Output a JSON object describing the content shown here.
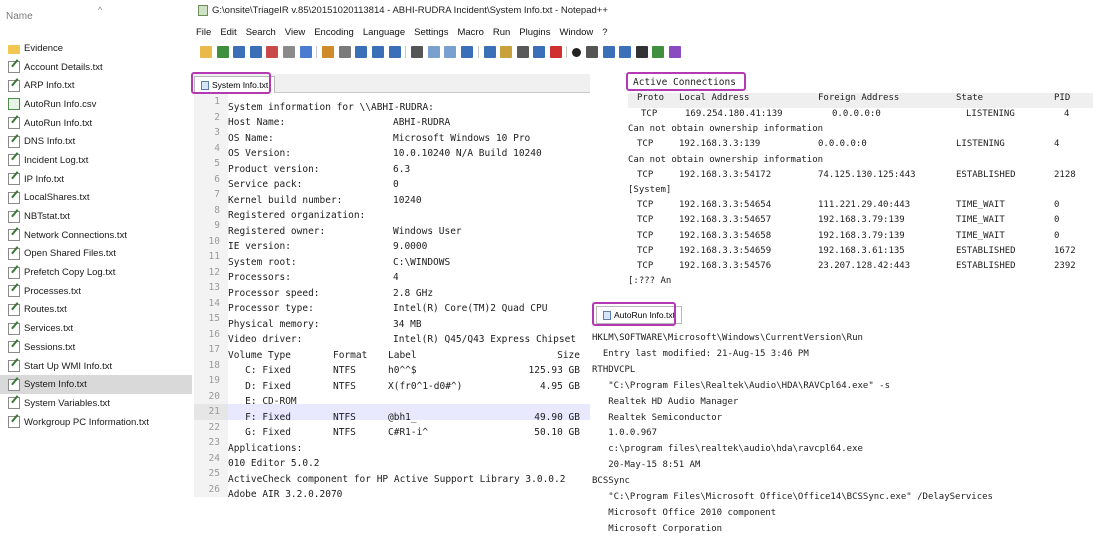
{
  "explorer": {
    "header": "Name",
    "sort_glyph": "^",
    "items": [
      {
        "label": "Evidence",
        "icon": "folder-icon"
      },
      {
        "label": "Account Details.txt",
        "icon": "text-file-icon"
      },
      {
        "label": "ARP Info.txt",
        "icon": "text-file-icon"
      },
      {
        "label": "AutoRun Info.csv",
        "icon": "csv-file-icon"
      },
      {
        "label": "AutoRun Info.txt",
        "icon": "text-file-icon"
      },
      {
        "label": "DNS Info.txt",
        "icon": "text-file-icon"
      },
      {
        "label": "Incident Log.txt",
        "icon": "text-file-icon"
      },
      {
        "label": "IP Info.txt",
        "icon": "text-file-icon"
      },
      {
        "label": "LocalShares.txt",
        "icon": "text-file-icon"
      },
      {
        "label": "NBTstat.txt",
        "icon": "text-file-icon"
      },
      {
        "label": "Network Connections.txt",
        "icon": "text-file-icon"
      },
      {
        "label": "Open Shared Files.txt",
        "icon": "text-file-icon"
      },
      {
        "label": "Prefetch Copy Log.txt",
        "icon": "text-file-icon"
      },
      {
        "label": "Processes.txt",
        "icon": "text-file-icon"
      },
      {
        "label": "Routes.txt",
        "icon": "text-file-icon"
      },
      {
        "label": "Services.txt",
        "icon": "text-file-icon"
      },
      {
        "label": "Sessions.txt",
        "icon": "text-file-icon"
      },
      {
        "label": "Start Up WMI Info.txt",
        "icon": "text-file-icon"
      },
      {
        "label": "System Info.txt",
        "icon": "text-file-icon",
        "selected": true
      },
      {
        "label": "System Variables.txt",
        "icon": "text-file-icon"
      },
      {
        "label": "Workgroup PC Information.txt",
        "icon": "text-file-icon"
      }
    ]
  },
  "window": {
    "title": "G:\\onsite\\TriageIR v.85\\20151020113814 - ABHI-RUDRA Incident\\System Info.txt - Notepad++",
    "menu": [
      "File",
      "Edit",
      "Search",
      "View",
      "Encoding",
      "Language",
      "Settings",
      "Macro",
      "Run",
      "Plugins",
      "Window",
      "?"
    ],
    "accent_highlight": "#b33ab3"
  },
  "editor": {
    "tab_label": "System Info.txt",
    "lines": [
      {
        "n": "1",
        "cols": [
          "System information for \\\\ABHI-RUDRA:"
        ]
      },
      {
        "n": "2",
        "cols": [
          "Host Name:",
          "ABHI-RUDRA"
        ]
      },
      {
        "n": "3",
        "cols": [
          "OS Name:",
          "Microsoft Windows 10 Pro"
        ]
      },
      {
        "n": "4",
        "cols": [
          "OS Version:",
          "10.0.10240 N/A Build 10240"
        ]
      },
      {
        "n": "5",
        "cols": [
          "Product version:",
          "6.3"
        ]
      },
      {
        "n": "6",
        "cols": [
          "Service pack:",
          "0"
        ]
      },
      {
        "n": "7",
        "cols": [
          "Kernel build number:",
          "10240"
        ]
      },
      {
        "n": "8",
        "cols": [
          "Registered organization:"
        ]
      },
      {
        "n": "9",
        "cols": [
          "Registered owner:",
          "Windows User"
        ]
      },
      {
        "n": "10",
        "cols": [
          "IE version:",
          "9.0000"
        ]
      },
      {
        "n": "11",
        "cols": [
          "System root:",
          "C:\\WINDOWS"
        ]
      },
      {
        "n": "12",
        "cols": [
          "Processors:",
          "4"
        ]
      },
      {
        "n": "13",
        "cols": [
          "Processor speed:",
          "2.8 GHz"
        ]
      },
      {
        "n": "14",
        "cols": [
          "Processor type:",
          "Intel(R) Core(TM)2 Quad CPU"
        ]
      },
      {
        "n": "15",
        "cols": [
          "Physical memory:",
          "34 MB"
        ]
      },
      {
        "n": "16",
        "cols": [
          "Video driver:",
          "Intel(R) Q45/Q43 Express Chipset"
        ]
      },
      {
        "n": "17",
        "cols": [
          "Volume Type",
          "Format",
          "Label",
          "Size"
        ],
        "vol": true
      },
      {
        "n": "18",
        "cols": [
          "   C: Fixed",
          "NTFS",
          "h0^^$",
          "125.93 GB"
        ],
        "vol": true
      },
      {
        "n": "19",
        "cols": [
          "   D: Fixed",
          "NTFS",
          "X(fr0^1-d0#^)",
          "4.95 GB"
        ],
        "vol": true
      },
      {
        "n": "20",
        "cols": [
          "   E: CD-ROM"
        ],
        "vol": true
      },
      {
        "n": "21",
        "cols": [
          "   F: Fixed",
          "NTFS",
          "@bh1_",
          "49.90 GB"
        ],
        "vol": true,
        "current": true
      },
      {
        "n": "22",
        "cols": [
          "   G: Fixed",
          "NTFS",
          "C#R1-i^",
          "50.10 GB"
        ],
        "vol": true
      },
      {
        "n": "23",
        "cols": [
          "Applications:"
        ]
      },
      {
        "n": "24",
        "cols": [
          "010 Editor 5.0.2"
        ]
      },
      {
        "n": "25",
        "cols": [
          "ActiveCheck component for HP Active Support Library 3.0.0.2"
        ]
      },
      {
        "n": "26",
        "cols": [
          "Adobe AIR 3.2.0.2070"
        ]
      }
    ]
  },
  "connections": {
    "title": "Active Connections",
    "headers": [
      "Proto",
      "Local Address",
      "Foreign Address",
      "State",
      "PID"
    ],
    "rows": [
      {
        "cells": [
          "TCP",
          "169.254.180.41:139",
          "0.0.0.0:0",
          "LISTENING",
          "4"
        ],
        "indent": true
      },
      {
        "text": "Can not obtain ownership information"
      },
      {
        "cells": [
          "TCP",
          "192.168.3.3:139",
          "0.0.0.0:0",
          "LISTENING",
          "4"
        ]
      },
      {
        "text": "Can not obtain ownership information"
      },
      {
        "cells": [
          "TCP",
          "192.168.3.3:54172",
          "74.125.130.125:443",
          "ESTABLISHED",
          "2128"
        ]
      },
      {
        "text": "[System]"
      },
      {
        "cells": [
          "TCP",
          "192.168.3.3:54654",
          "111.221.29.40:443",
          "TIME_WAIT",
          "0"
        ]
      },
      {
        "cells": [
          "TCP",
          "192.168.3.3:54657",
          "192.168.3.79:139",
          "TIME_WAIT",
          "0"
        ]
      },
      {
        "cells": [
          "TCP",
          "192.168.3.3:54658",
          "192.168.3.79:139",
          "TIME_WAIT",
          "0"
        ]
      },
      {
        "cells": [
          "TCP",
          "192.168.3.3:54659",
          "192.168.3.61:135",
          "ESTABLISHED",
          "1672"
        ]
      },
      {
        "cells": [
          "TCP",
          "192.168.3.3:54576",
          "23.207.128.42:443",
          "ESTABLISHED",
          "2392"
        ]
      },
      {
        "text": "[:??? An"
      }
    ]
  },
  "autorun": {
    "tab_label": "AutoRun Info.txt",
    "lines": [
      "HKLM\\SOFTWARE\\Microsoft\\Windows\\CurrentVersion\\Run",
      "  Entry last modified: 21-Aug-15 3:46 PM",
      "RTHDVCPL",
      "   \"C:\\Program Files\\Realtek\\Audio\\HDA\\RAVCpl64.exe\" -s",
      "   Realtek HD Audio Manager",
      "   Realtek Semiconductor",
      "   1.0.0.967",
      "   c:\\program files\\realtek\\audio\\hda\\ravcpl64.exe",
      "   20-May-15 8:51 AM",
      "BCSSync",
      "   \"C:\\Program Files\\Microsoft Office\\Office14\\BCSSync.exe\" /DelayServices",
      "   Microsoft Office 2010 component",
      "   Microsoft Corporation"
    ]
  }
}
